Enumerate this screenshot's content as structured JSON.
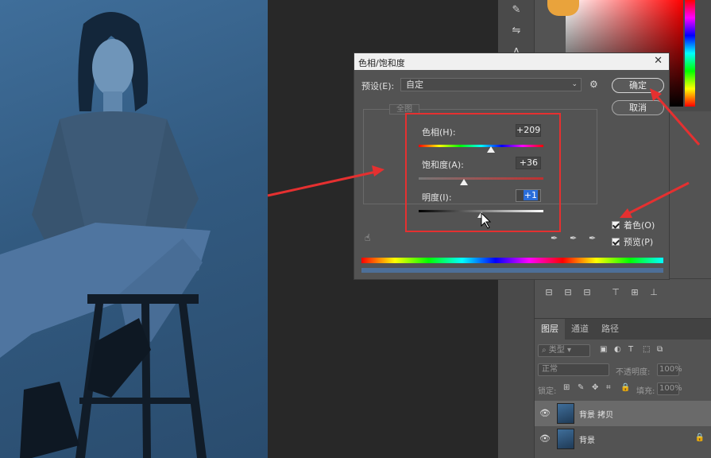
{
  "dialog": {
    "title": "色相/饱和度",
    "preset_label": "预设(E):",
    "preset_value": "自定",
    "ok_label": "确定",
    "cancel_label": "取消",
    "range_value": "全图",
    "hue": {
      "label": "色相(H):",
      "value": "+209",
      "position": 0.58
    },
    "saturation": {
      "label": "饱和度(A):",
      "value": "+36",
      "position": 0.36
    },
    "lightness": {
      "label": "明度(I):",
      "value": "+1",
      "position": 0.5
    },
    "colorize": {
      "label": "着色(O)",
      "checked": true
    },
    "preview": {
      "label": "预览(P)",
      "checked": true
    }
  },
  "layers": {
    "tabs": [
      "图层",
      "通道",
      "路径"
    ],
    "filter_kind": "类型",
    "blend_mode": "正常",
    "opacity_label": "不透明度:",
    "opacity_value": "100%",
    "lock_label": "锁定:",
    "fill_label": "填充:",
    "fill_value": "100%",
    "items": [
      {
        "name": "背景 拷贝",
        "selected": true
      },
      {
        "name": "背景",
        "selected": false,
        "locked": true
      }
    ]
  },
  "colors": {
    "highlight": "#e53030",
    "panel_bg": "#535353",
    "photo_tint": "#3f6e9a"
  }
}
